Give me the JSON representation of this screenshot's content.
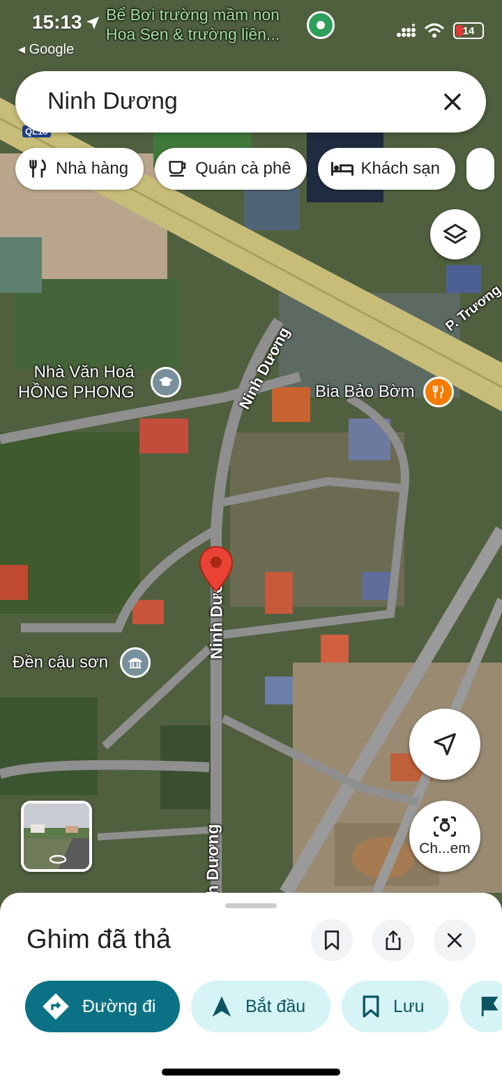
{
  "status": {
    "time": "15:13",
    "back_app": "◂ Google",
    "battery": "14"
  },
  "top_poi": {
    "line1": "Bể Bơi trường mầm non",
    "line2": "Hoa Sen & trường liên..."
  },
  "search": {
    "query": "Ninh Dương"
  },
  "chips": [
    {
      "label": "Nhà hàng",
      "icon": "fork-knife-icon"
    },
    {
      "label": "Quán cà phê",
      "icon": "coffee-cup-icon"
    },
    {
      "label": "Khách sạn",
      "icon": "bed-icon"
    }
  ],
  "map_labels": {
    "road_shield": "QL18",
    "street_top": "Ninh Dương",
    "street_mid": "Ninh Dươ",
    "street_bottom": "h Dương",
    "street_right": "P. Trương",
    "culture_house_line1": "Nhà Văn Hoá",
    "culture_house_line2": "HỒNG PHONG",
    "restaurant": "Bia Bảo Bờm",
    "temple": "Đền cậu sơn"
  },
  "buttons": {
    "lens_label": "Ch...em"
  },
  "sheet": {
    "title": "Ghim đã thả",
    "actions": [
      {
        "label": "Đường đi",
        "icon": "directions-icon"
      },
      {
        "label": "Bắt đầu",
        "icon": "navigation-arrow-icon"
      },
      {
        "label": "Lưu",
        "icon": "bookmark-icon"
      }
    ]
  },
  "colors": {
    "accent": "#0b7285",
    "secondary_bg": "#d6f3f5",
    "pin": "#ea4335",
    "poi_food": "#f57c00",
    "poi_landmark": "#78909c"
  }
}
